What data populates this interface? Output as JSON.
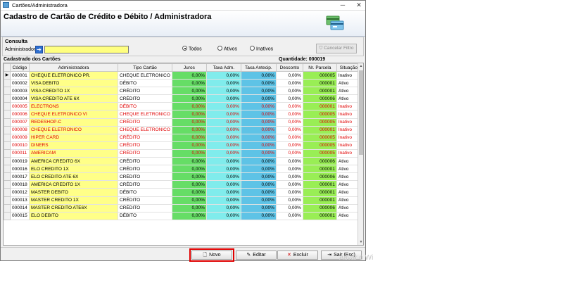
{
  "window": {
    "title": "Cartões/Administradora",
    "minimize": "─",
    "close": "✕"
  },
  "header": {
    "title": "Cadastro de Cartão de Crédito e Débito / Administradora"
  },
  "consulta": {
    "label": "Consulta",
    "admin_label": "Administradora",
    "admin_value": "",
    "radios": [
      {
        "label": "Todos",
        "checked": true
      },
      {
        "label": "Ativos",
        "checked": false
      },
      {
        "label": "Inativos",
        "checked": false
      }
    ],
    "cancel_button": "Cancelar Filtro"
  },
  "list": {
    "title": "Cadastrado dos Cartões",
    "quantity": "Quantidade: 000019",
    "columns": [
      "Código",
      "Administradora",
      "Tipo Cartão",
      "Juros",
      "Taxa Adm.",
      "Taxa Antecip.",
      "Desconto",
      "Nr. Parcela",
      "Situação"
    ],
    "rows": [
      {
        "codigo": "000001",
        "adm": "CHEQUE ELETRONICO PR.",
        "tipo": "CHEQUE ELETRONICO",
        "juros": "0,00%",
        "taxa": "0,00%",
        "antecip": "0,00%",
        "desc": "0,00%",
        "parcela": "000005",
        "sit": "Inativo",
        "red": false,
        "current": true
      },
      {
        "codigo": "000002",
        "adm": "VISA DEBITO",
        "tipo": "DÉBITO",
        "juros": "0,00%",
        "taxa": "0,00%",
        "antecip": "0,00%",
        "desc": "0,00%",
        "parcela": "000001",
        "sit": "Ativo",
        "red": false
      },
      {
        "codigo": "000003",
        "adm": "VISA CREDITO 1X",
        "tipo": "CRÉDITO",
        "juros": "0,00%",
        "taxa": "0,00%",
        "antecip": "0,00%",
        "desc": "0,00%",
        "parcela": "000001",
        "sit": "Ativo",
        "red": false
      },
      {
        "codigo": "000004",
        "adm": "VISA CREDITO ATE 6X",
        "tipo": "CRÉDITO",
        "juros": "0,00%",
        "taxa": "0,00%",
        "antecip": "0,00%",
        "desc": "0,00%",
        "parcela": "000006",
        "sit": "Ativo",
        "red": false
      },
      {
        "codigo": "000005",
        "adm": "ELECTRONS",
        "tipo": "DÉBITO",
        "juros": "0,00%",
        "taxa": "0,00%",
        "antecip": "0,00%",
        "desc": "0,00%",
        "parcela": "000001",
        "sit": "Inativo",
        "red": true
      },
      {
        "codigo": "000006",
        "adm": "CHEQUE ELETRONICO VI",
        "tipo": "CHEQUE ELETRONICO",
        "juros": "0,00%",
        "taxa": "0,00%",
        "antecip": "0,00%",
        "desc": "0,00%",
        "parcela": "000005",
        "sit": "Inativo",
        "red": true
      },
      {
        "codigo": "000007",
        "adm": "REDESHOP-C",
        "tipo": "CRÉDITO",
        "juros": "0,00%",
        "taxa": "0,00%",
        "antecip": "0,00%",
        "desc": "0,00%",
        "parcela": "000005",
        "sit": "Inativo",
        "red": true
      },
      {
        "codigo": "000008",
        "adm": "CHEQUE ELETRONICO",
        "tipo": "CHEQUE ELETRONICO",
        "juros": "0,00%",
        "taxa": "0,00%",
        "antecip": "0,00%",
        "desc": "0,00%",
        "parcela": "000001",
        "sit": "Inativo",
        "red": true
      },
      {
        "codigo": "000009",
        "adm": "HIPER CARD",
        "tipo": "CRÉDITO",
        "juros": "0,00%",
        "taxa": "0,00%",
        "antecip": "0,00%",
        "desc": "0,00%",
        "parcela": "000005",
        "sit": "Inativo",
        "red": true
      },
      {
        "codigo": "000010",
        "adm": "DINERS",
        "tipo": "CRÉDITO",
        "juros": "0,00%",
        "taxa": "0,00%",
        "antecip": "0,00%",
        "desc": "0,00%",
        "parcela": "000005",
        "sit": "Inativo",
        "red": true
      },
      {
        "codigo": "000011",
        "adm": "AMERICAM",
        "tipo": "CRÉDITO",
        "juros": "0,00%",
        "taxa": "0,00%",
        "antecip": "0,00%",
        "desc": "0,00%",
        "parcela": "000005",
        "sit": "Inativo",
        "red": true
      },
      {
        "codigo": "000019",
        "adm": "AMERICA CREDITO 6X",
        "tipo": "CRÉDITO",
        "juros": "0,00%",
        "taxa": "0,00%",
        "antecip": "0,00%",
        "desc": "0,00%",
        "parcela": "000006",
        "sit": "Ativo",
        "red": false
      },
      {
        "codigo": "000016",
        "adm": "ELO CREDITO 1X",
        "tipo": "CRÉDITO",
        "juros": "0,00%",
        "taxa": "0,00%",
        "antecip": "0,00%",
        "desc": "0,00%",
        "parcela": "000001",
        "sit": "Ativo",
        "red": false
      },
      {
        "codigo": "000017",
        "adm": "ELO CREDITO ATE 6X",
        "tipo": "CRÉDITO",
        "juros": "0,00%",
        "taxa": "0,00%",
        "antecip": "0,00%",
        "desc": "0,00%",
        "parcela": "000006",
        "sit": "Ativo",
        "red": false
      },
      {
        "codigo": "000018",
        "adm": "AMERICA CREDITO 1X",
        "tipo": "CRÉDITO",
        "juros": "0,00%",
        "taxa": "0,00%",
        "antecip": "0,00%",
        "desc": "0,00%",
        "parcela": "000001",
        "sit": "Ativo",
        "red": false
      },
      {
        "codigo": "000012",
        "adm": "MASTER DEBITO",
        "tipo": "DÉBITO",
        "juros": "0,00%",
        "taxa": "0,00%",
        "antecip": "0,00%",
        "desc": "0,00%",
        "parcela": "000001",
        "sit": "Ativo",
        "red": false
      },
      {
        "codigo": "000013",
        "adm": "MASTER CREDITO 1X",
        "tipo": "CRÉDITO",
        "juros": "0,00%",
        "taxa": "0,00%",
        "antecip": "0,00%",
        "desc": "0,00%",
        "parcela": "000001",
        "sit": "Ativo",
        "red": false
      },
      {
        "codigo": "000014",
        "adm": "MASTER CREDITO ATE6X",
        "tipo": "CRÉDITO",
        "juros": "0,00%",
        "taxa": "0,00%",
        "antecip": "0,00%",
        "desc": "0,00%",
        "parcela": "000006",
        "sit": "Ativo",
        "red": false
      },
      {
        "codigo": "000015",
        "adm": "ELO DEBITO",
        "tipo": "DÉBITO",
        "juros": "0,00%",
        "taxa": "0,00%",
        "antecip": "0,00%",
        "desc": "0,00%",
        "parcela": "000001",
        "sit": "Ativo",
        "red": false
      }
    ]
  },
  "buttons": {
    "novo": "Novo",
    "editar": "Editar",
    "excluir": "Excluir",
    "sair": "Sair (Esc)"
  },
  "colors": {
    "highlight": "#e00000",
    "inactive_text": "#e00000",
    "admin_cell": "#ffff88",
    "juros_cell": "#66dd66",
    "taxa_cell": "#80ecec",
    "antecip_cell": "#5ec3e6",
    "parcela_cell": "#99ee55"
  },
  "watermark": "Ativar o Wi"
}
